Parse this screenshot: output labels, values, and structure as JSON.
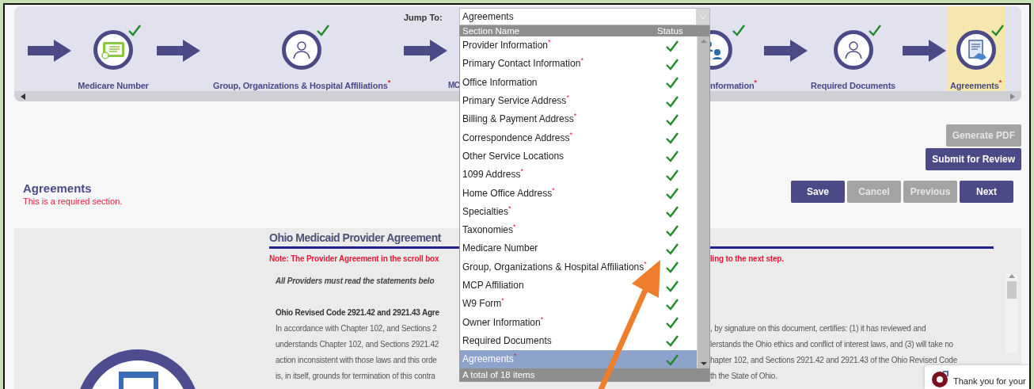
{
  "stepper": {
    "jump_label": "Jump To:",
    "steps_left": [
      {
        "label": "Medicare Number",
        "done": true,
        "selected": false
      },
      {
        "label": "Group, Organizations & Hospital Affiliations$^{*}$",
        "done": true,
        "selected": false
      },
      {
        "label": "MC"
      }
    ],
    "steps_right": [
      {
        "label": "nformation$^{*}$",
        "done": true,
        "selected": false
      },
      {
        "label": "Required Documents",
        "done": true,
        "selected": false
      },
      {
        "label": "Agreements$^{*}$",
        "done": true,
        "selected": true
      }
    ]
  },
  "jump_to": {
    "value": "Agreements",
    "columns": [
      "Section Name",
      "Status"
    ],
    "rows": [
      {
        "label": "Provider Information$^{*}$",
        "done": true,
        "selected": false
      },
      {
        "label": "Primary Contact Information$^{*}$",
        "done": true,
        "selected": false
      },
      {
        "label": "Office Information",
        "done": true,
        "selected": false
      },
      {
        "label": "Primary Service Address$^{*}$",
        "done": true,
        "selected": false
      },
      {
        "label": "Billing & Payment Address$^{*}$",
        "done": true,
        "selected": false
      },
      {
        "label": "Correspondence Address$^{*}$",
        "done": true,
        "selected": false
      },
      {
        "label": "Other Service Locations",
        "done": true,
        "selected": false
      },
      {
        "label": "1099 Address$^{*}$",
        "done": true,
        "selected": false
      },
      {
        "label": "Home Office Address$^{*}$",
        "done": true,
        "selected": false
      },
      {
        "label": "Specialties$^{*}$",
        "done": true,
        "selected": false
      },
      {
        "label": "Taxonomies$^{*}$",
        "done": true,
        "selected": false
      },
      {
        "label": "Medicare Number",
        "done": true,
        "selected": false
      },
      {
        "label": "Group, Organizations & Hospital Affiliations$^{*}$",
        "done": true,
        "selected": false
      },
      {
        "label": "MCP Affiliation",
        "done": true,
        "selected": false
      },
      {
        "label": "W9 Form$^{*}$",
        "done": true,
        "selected": false
      },
      {
        "label": "Owner Information$^{*}$",
        "done": true,
        "selected": false
      },
      {
        "label": "Required Documents",
        "done": true,
        "selected": false
      },
      {
        "label": "Agreements$^{*}$",
        "done": true,
        "selected": true
      }
    ],
    "footer": "A total of 18 items"
  },
  "section": {
    "title": "Agreements",
    "note": "This is a required section."
  },
  "actions": {
    "top": [
      {
        "label": "Generate PDF",
        "disabled": true
      },
      {
        "label": "Submit for Review",
        "disabled": false
      }
    ],
    "row": [
      {
        "label": "Save",
        "disabled": false
      },
      {
        "label": "Cancel",
        "disabled": true
      },
      {
        "label": "Previous",
        "disabled": true
      },
      {
        "label": "Next",
        "disabled": false
      }
    ]
  },
  "agreement": {
    "title": "Ohio Medicaid Provider Agreement",
    "note_left": "Note: The Provider Agreement in the scroll box",
    "note_right": "ling to the next step.",
    "intro": "All Providers must read the statements belo",
    "heading": "Ohio Revised Code 2921.42 and 2921.43 Agre",
    "lines": [
      {
        "left": "In accordance with Chapter 102, and Sections 2",
        "right": ", by signature on this document, certifies: (1) it has reviewed and"
      },
      {
        "left": "understands Chapter 102, and Sections 2921.42",
        "right": "lerstands the Ohio ethics and conflict of interest laws, and (3) will take no"
      },
      {
        "left": "action inconsistent with those laws and this orde",
        "right": "hapter 102, and Sections 2921.42 and 2921.43 of the Ohio Revised Code"
      },
      {
        "left": "is, in itself, grounds for termination of this contra",
        "right": "th the State of Ohio."
      }
    ]
  },
  "chat": {
    "text": "Thank you for your"
  }
}
